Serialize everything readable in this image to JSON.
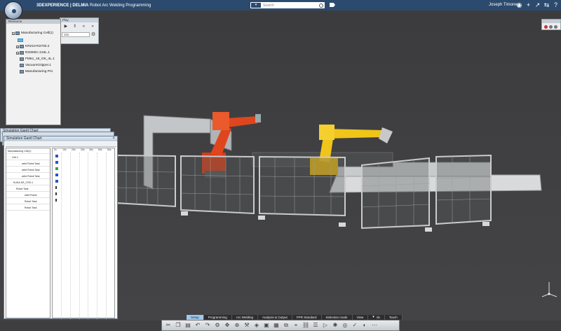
{
  "app": {
    "brand": "3DEXPERIENCE | DELMIA",
    "module": "Robot Arc Welding Programming",
    "search_placeholder": "Search",
    "user": "Joseph Timoney"
  },
  "play_panel": {
    "title": "Play",
    "speed_value": "10x"
  },
  "tree": {
    "title": "Resource",
    "items": [
      {
        "label": "Manufacturing Cell(1)"
      },
      {
        "label": ""
      },
      {
        "label": "KR210-R2700.2"
      },
      {
        "label": "R2000iC-210L.1"
      },
      {
        "label": "FM51_18_OK_4L.1"
      },
      {
        "label": "VacuumGripper.1"
      },
      {
        "label": "Manufacturing Pro"
      }
    ]
  },
  "gantt": {
    "back_title": "Simulation Gantt Chart",
    "title": "Simulation Gantt Chart",
    "columns": [
      "0s",
      "10s",
      "20s",
      "30s",
      "40s",
      "50s",
      "60s"
    ],
    "rows": [
      {
        "label": "Manufacturing Cell(1)"
      },
      {
        "label": "Cell.1"
      },
      {
        "label": "weld Robot Task"
      },
      {
        "label": "weld Robot Task"
      },
      {
        "label": "weld Robot Task"
      },
      {
        "label": "KUKA-KR_2700.1"
      },
      {
        "label": "Robot Task"
      },
      {
        "label": "weld Robot"
      },
      {
        "label": "Robot Task"
      },
      {
        "label": "Robot Task"
      }
    ]
  },
  "bottom_tabs": [
    {
      "label": "Setup",
      "active": true
    },
    {
      "label": "Programming"
    },
    {
      "label": "Arc Welding"
    },
    {
      "label": "Analysis & Output"
    },
    {
      "label": "PPR Standard"
    },
    {
      "label": "Selection mode"
    },
    {
      "label": "View"
    },
    {
      "label": "Tools"
    },
    {
      "label": "Touch"
    }
  ],
  "colors": {
    "topbar": "#2b4a6e",
    "robot_kuka": "#e0461e",
    "robot_fanuc": "#f0c419",
    "active_tab": "#9fc9ea",
    "gantt_bar": "#1e56c9"
  }
}
